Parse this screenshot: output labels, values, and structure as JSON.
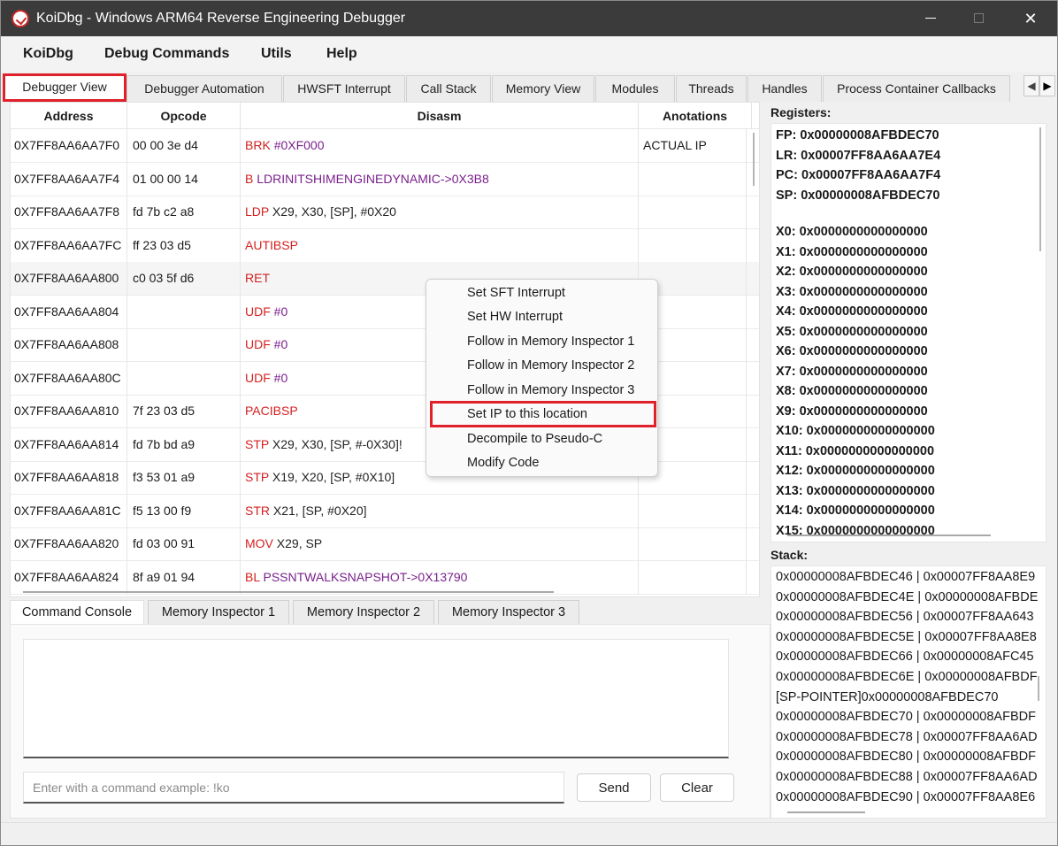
{
  "window": {
    "title": "KoiDbg - Windows ARM64 Reverse Engineering Debugger",
    "close_glyph": "✕"
  },
  "menu": [
    "KoiDbg",
    "Debug Commands",
    "Utils",
    "Help"
  ],
  "tabs": [
    "Debugger View",
    "Debugger Automation",
    "HWSFT Interrupt",
    "Call Stack",
    "Memory View",
    "Modules",
    "Threads",
    "Handles",
    "Process Container Callbacks"
  ],
  "tab_scroll": {
    "left": "◀",
    "right": "▶"
  },
  "grid": {
    "headers": {
      "address": "Address",
      "opcode": "Opcode",
      "disasm": "Disasm",
      "annotations": "Anotations"
    },
    "rows": [
      {
        "address": "0X7FF8AA6AA7F0",
        "opcode": "00 00 3e d4",
        "mnemonic": "BRK",
        "args": "#0XF000",
        "args_style": "purple",
        "annotation": "ACTUAL IP"
      },
      {
        "address": "0X7FF8AA6AA7F4",
        "opcode": "01 00 00 14",
        "mnemonic": "B",
        "args": "LDRINITSHIMENGINEDYNAMIC->0X3B8",
        "args_style": "purple",
        "annotation": ""
      },
      {
        "address": "0X7FF8AA6AA7F8",
        "opcode": "fd 7b c2 a8",
        "mnemonic": "LDP",
        "args": "X29, X30, [SP], #0X20",
        "args_style": "plain",
        "annotation": ""
      },
      {
        "address": "0X7FF8AA6AA7FC",
        "opcode": "ff 23 03 d5",
        "mnemonic": "AUTIBSP",
        "args": "",
        "args_style": "plain",
        "annotation": ""
      },
      {
        "address": "0X7FF8AA6AA800",
        "opcode": "c0 03 5f d6",
        "mnemonic": "RET",
        "args": "",
        "args_style": "plain",
        "annotation": ""
      },
      {
        "address": "0X7FF8AA6AA804",
        "opcode": "",
        "mnemonic": "UDF",
        "args": "#0",
        "args_style": "purple",
        "annotation": ""
      },
      {
        "address": "0X7FF8AA6AA808",
        "opcode": "",
        "mnemonic": "UDF",
        "args": "#0",
        "args_style": "purple",
        "annotation": ""
      },
      {
        "address": "0X7FF8AA6AA80C",
        "opcode": "",
        "mnemonic": "UDF",
        "args": "#0",
        "args_style": "purple",
        "annotation": ""
      },
      {
        "address": "0X7FF8AA6AA810",
        "opcode": "7f 23 03 d5",
        "mnemonic": "PACIBSP",
        "args": "",
        "args_style": "plain",
        "annotation": ""
      },
      {
        "address": "0X7FF8AA6AA814",
        "opcode": "fd 7b bd a9",
        "mnemonic": "STP",
        "args": "X29, X30, [SP, #-0X30]!",
        "args_style": "plain",
        "annotation": ""
      },
      {
        "address": "0X7FF8AA6AA818",
        "opcode": "f3 53 01 a9",
        "mnemonic": "STP",
        "args": "X19, X20, [SP, #0X10]",
        "args_style": "plain",
        "annotation": ""
      },
      {
        "address": "0X7FF8AA6AA81C",
        "opcode": "f5 13 00 f9",
        "mnemonic": "STR",
        "args": "X21, [SP, #0X20]",
        "args_style": "plain",
        "annotation": ""
      },
      {
        "address": "0X7FF8AA6AA820",
        "opcode": "fd 03 00 91",
        "mnemonic": "MOV",
        "args": "X29, SP",
        "args_style": "plain",
        "annotation": ""
      },
      {
        "address": "0X7FF8AA6AA824",
        "opcode": "8f a9 01 94",
        "mnemonic": "BL",
        "args": "PSSNTWALKSNAPSHOT->0X13790",
        "args_style": "purple",
        "annotation": ""
      }
    ]
  },
  "context_menu": [
    "Set SFT Interrupt",
    "Set HW Interrupt",
    "Follow in Memory Inspector 1",
    "Follow in Memory Inspector 2",
    "Follow in Memory Inspector 3",
    "Set IP to this location",
    "Decompile to Pseudo-C",
    "Modify Code"
  ],
  "bottom_tabs": [
    "Command Console",
    "Memory Inspector 1",
    "Memory Inspector 2",
    "Memory Inspector 3"
  ],
  "console": {
    "placeholder": "Enter with a command example: !ko",
    "send_label": "Send",
    "clear_label": "Clear"
  },
  "registers": {
    "label": "Registers:",
    "special": [
      "FP: 0x00000008AFBDEC70",
      "LR: 0x00007FF8AA6AA7E4",
      "PC: 0x00007FF8AA6AA7F4",
      "SP: 0x00000008AFBDEC70"
    ],
    "general": [
      "X0: 0x0000000000000000",
      "X1: 0x0000000000000000",
      "X2: 0x0000000000000000",
      "X3: 0x0000000000000000",
      "X4: 0x0000000000000000",
      "X5: 0x0000000000000000",
      "X6: 0x0000000000000000",
      "X7: 0x0000000000000000",
      "X8: 0x0000000000000000",
      "X9: 0x0000000000000000",
      "X10: 0x0000000000000000",
      "X11: 0x0000000000000000",
      "X12: 0x0000000000000000",
      "X13: 0x0000000000000000",
      "X14: 0x0000000000000000",
      "X15: 0x0000000000000000"
    ]
  },
  "stack": {
    "label": "Stack:",
    "lines": [
      "0x00000008AFBDEC46 | 0x00007FF8AA8E9",
      "0x00000008AFBDEC4E | 0x00000008AFBDE",
      "0x00000008AFBDEC56 | 0x00007FF8AA643",
      "0x00000008AFBDEC5E | 0x00007FF8AA8E8",
      "0x00000008AFBDEC66 | 0x00000008AFC45",
      "0x00000008AFBDEC6E | 0x00000008AFBDF",
      "[SP-POINTER]0x00000008AFBDEC70",
      "0x00000008AFBDEC70 | 0x00000008AFBDF",
      "0x00000008AFBDEC78 | 0x00007FF8AA6AD",
      "0x00000008AFBDEC80 | 0x00000008AFBDF",
      "0x00000008AFBDEC88 | 0x00007FF8AA6AD",
      "0x00000008AFBDEC90 | 0x00007FF8AA8E6"
    ]
  }
}
